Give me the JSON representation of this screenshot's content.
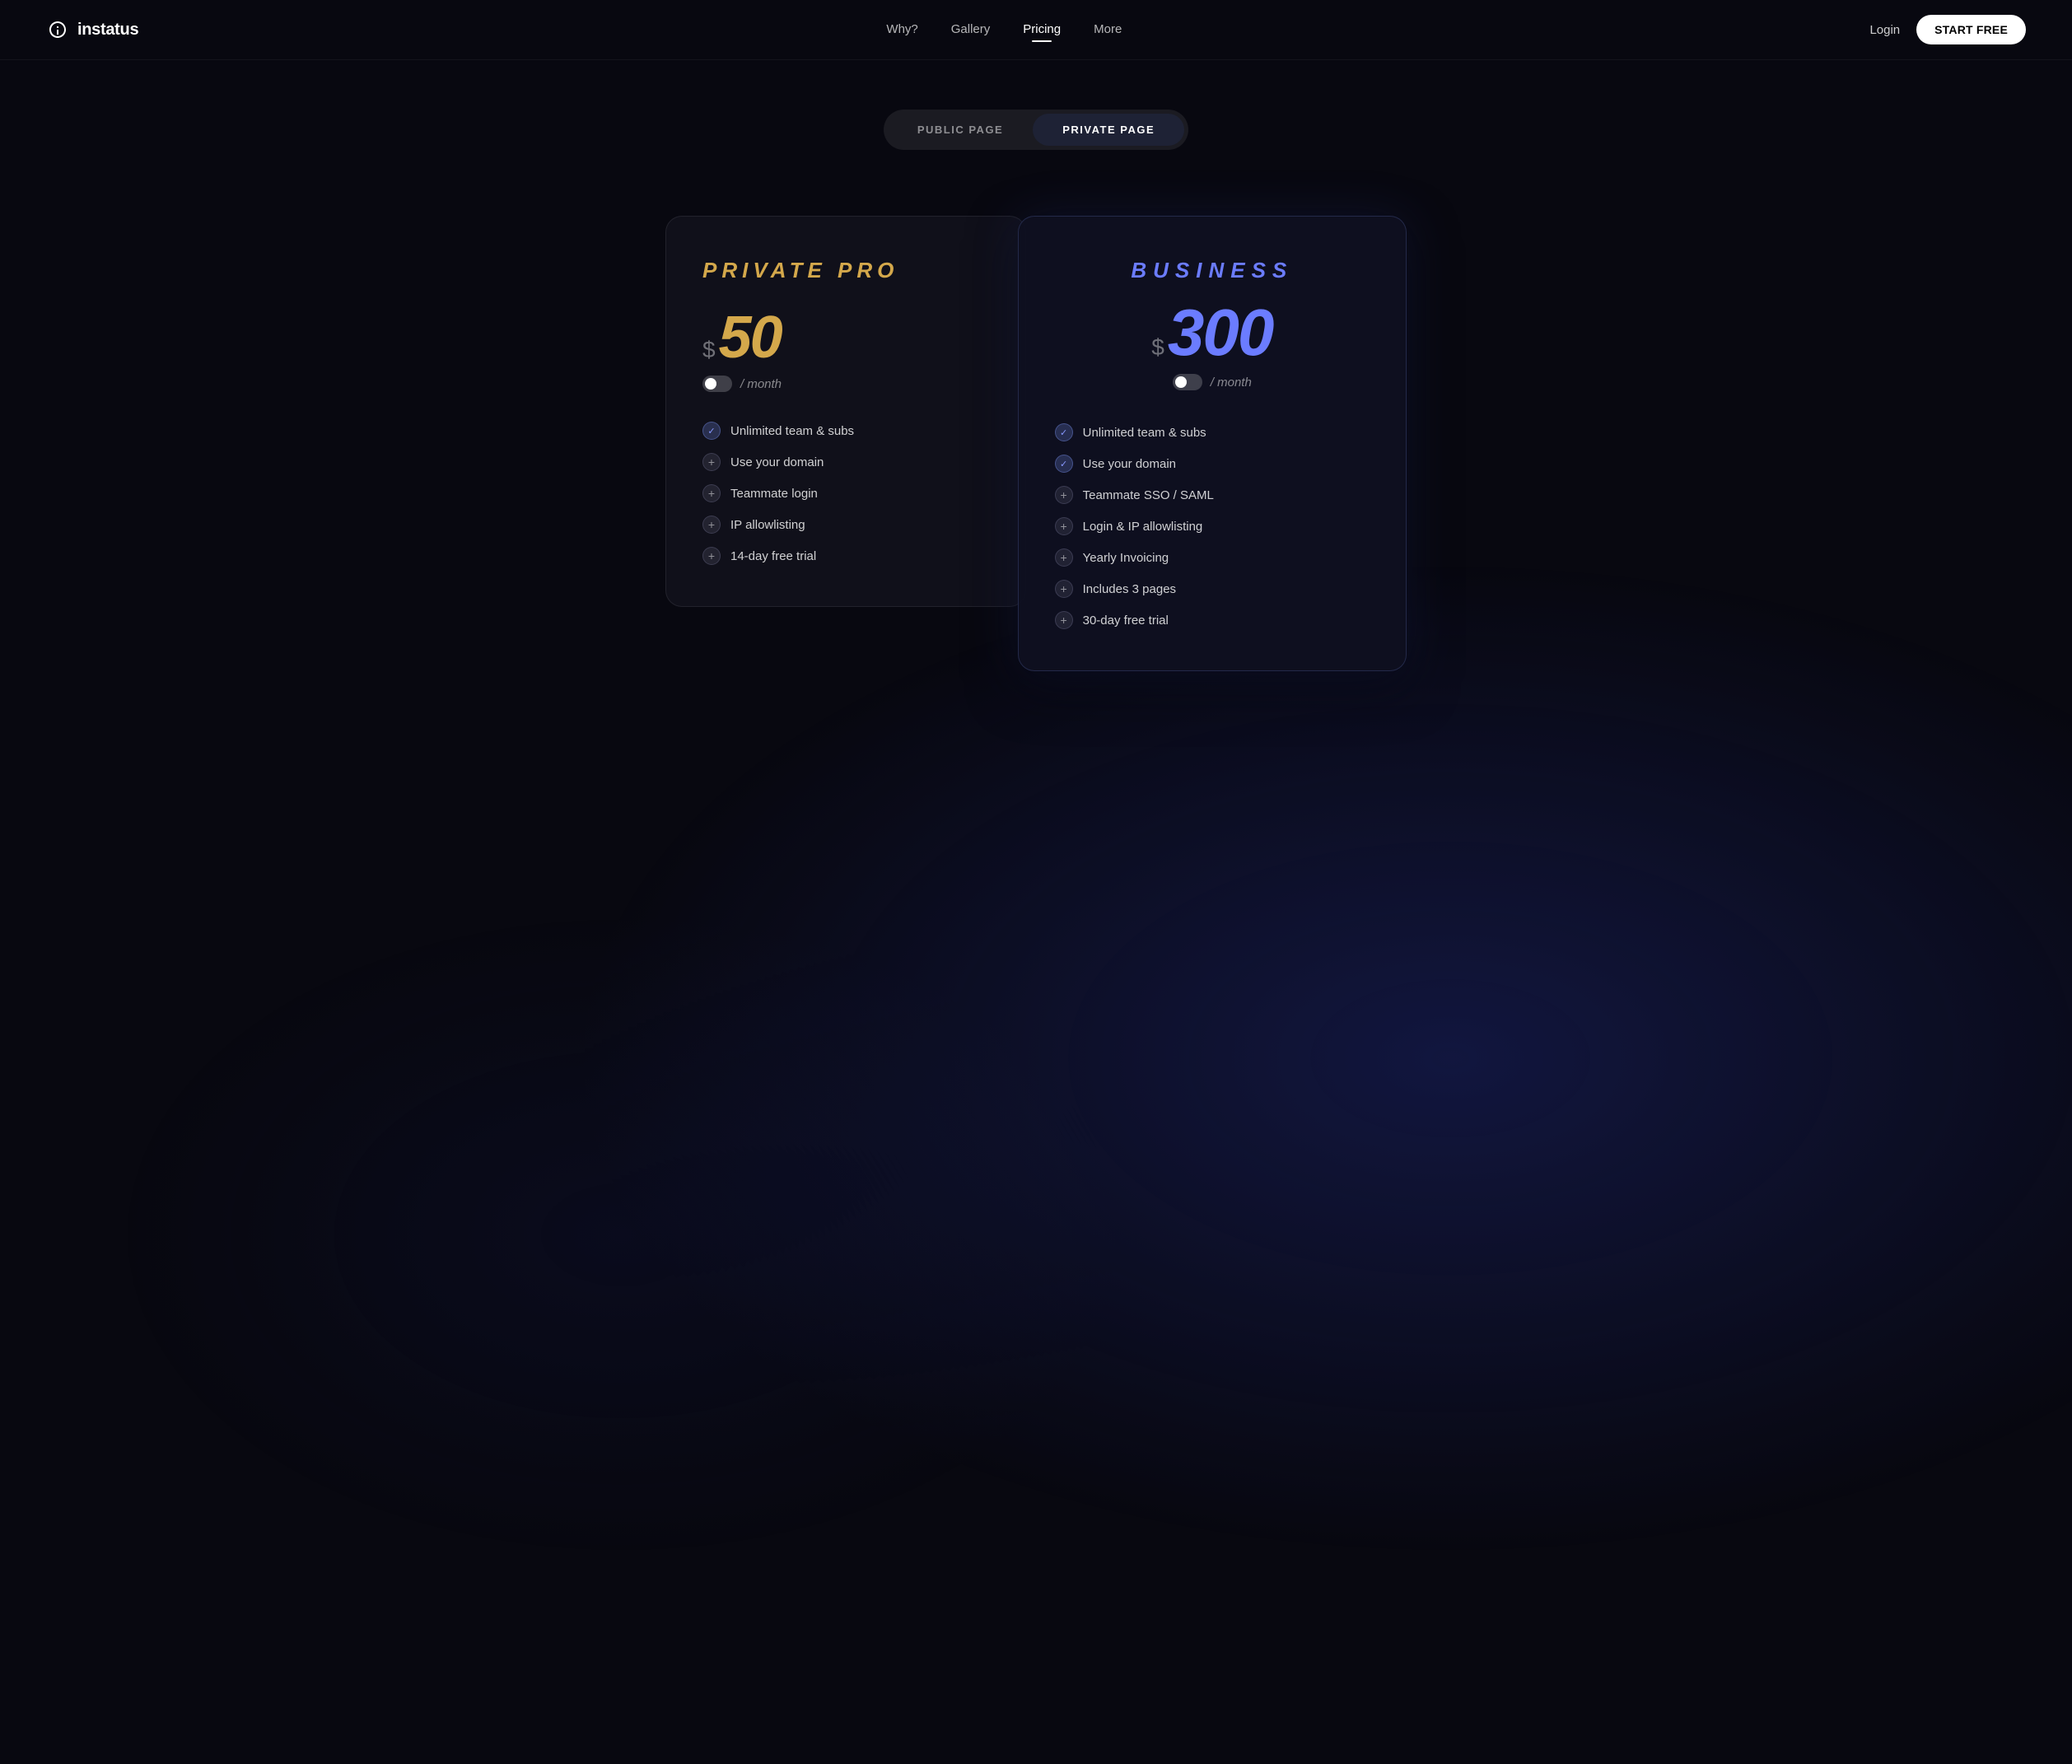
{
  "nav": {
    "logo_text": "instatus",
    "links": [
      {
        "id": "why",
        "label": "Why?",
        "active": false
      },
      {
        "id": "gallery",
        "label": "Gallery",
        "active": false
      },
      {
        "id": "pricing",
        "label": "Pricing",
        "active": true
      },
      {
        "id": "more",
        "label": "More",
        "active": false
      }
    ],
    "login_label": "Login",
    "start_free_label": "START FREE"
  },
  "toggle": {
    "public_label": "PUBLIC PAGE",
    "private_label": "PRIVATE PAGE",
    "active": "private"
  },
  "private_pro": {
    "title": "PRIVATE PRO",
    "currency": "$",
    "price": "50",
    "per_month": "/ month",
    "features": [
      {
        "type": "check",
        "text": "Unlimited team & subs"
      },
      {
        "type": "plus",
        "text": "Use your domain"
      },
      {
        "type": "plus",
        "text": "Teammate login"
      },
      {
        "type": "plus",
        "text": "IP allowlisting"
      },
      {
        "type": "plus",
        "text": "14-day free trial"
      }
    ]
  },
  "business": {
    "title": "BUSINESS",
    "currency": "$",
    "price": "300",
    "per_month": "/ month",
    "features": [
      {
        "type": "check",
        "text": "Unlimited team & subs"
      },
      {
        "type": "check",
        "text": "Use your domain"
      },
      {
        "type": "plus",
        "text": "Teammate SSO / SAML"
      },
      {
        "type": "plus",
        "text": "Login & IP allowlisting"
      },
      {
        "type": "plus",
        "text": "Yearly Invoicing"
      },
      {
        "type": "plus",
        "text": "Includes 3 pages"
      },
      {
        "type": "plus",
        "text": "30-day free trial"
      }
    ]
  }
}
